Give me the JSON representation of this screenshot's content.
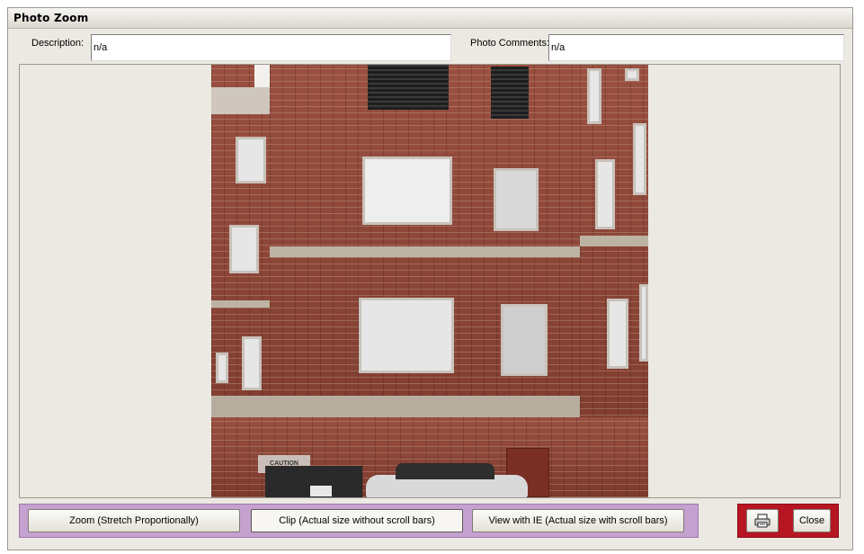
{
  "window": {
    "title": "Photo Zoom"
  },
  "fields": {
    "description_label": "Description:",
    "description_value": "n/a",
    "comments_label": "Photo Comments:",
    "comments_value": "n/a"
  },
  "photo": {
    "sign_text": "CAUTION",
    "subject": "brick-building-photo"
  },
  "buttons": {
    "zoom": "Zoom (Stretch Proportionally)",
    "clip": "Clip (Actual size without scroll bars)",
    "view_ie": "View with IE (Actual size with scroll bars)",
    "print_icon": "printer-icon",
    "close": "Close"
  },
  "colors": {
    "view_button_group": "#c4a1cf",
    "action_button_group": "#b81523",
    "window_background": "#ece9e2"
  }
}
